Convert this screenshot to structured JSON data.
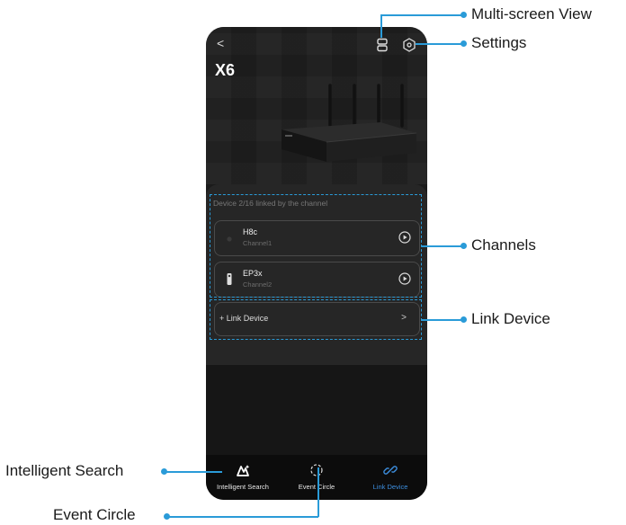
{
  "device": {
    "title": "X6",
    "back_glyph": "<"
  },
  "panel": {
    "caption": "Device 2/16 linked by the channel",
    "channels": [
      {
        "name": "H8c",
        "sub": "Channel1",
        "icon": "camera-icon"
      },
      {
        "name": "EP3x",
        "sub": "Channel2",
        "icon": "doorbell-icon"
      }
    ],
    "link_label": "+ Link Device",
    "link_chevron": ">"
  },
  "bottom_nav": [
    {
      "label": "Intelligent Search",
      "icon": "intelligent-search-icon",
      "active": false
    },
    {
      "label": "Event Circle",
      "icon": "event-circle-icon",
      "active": false
    },
    {
      "label": "Link Device",
      "icon": "link-icon",
      "active": true
    }
  ],
  "callouts": {
    "multiscreen": "Multi-screen View",
    "settings": "Settings",
    "channels": "Channels",
    "link_device": "Link Device",
    "intelligent_search": "Intelligent Search",
    "event_circle": "Event Circle"
  },
  "colors": {
    "accent": "#2a9bd8",
    "active_tab": "#3d8fe0",
    "background": "#1b1b1b"
  }
}
